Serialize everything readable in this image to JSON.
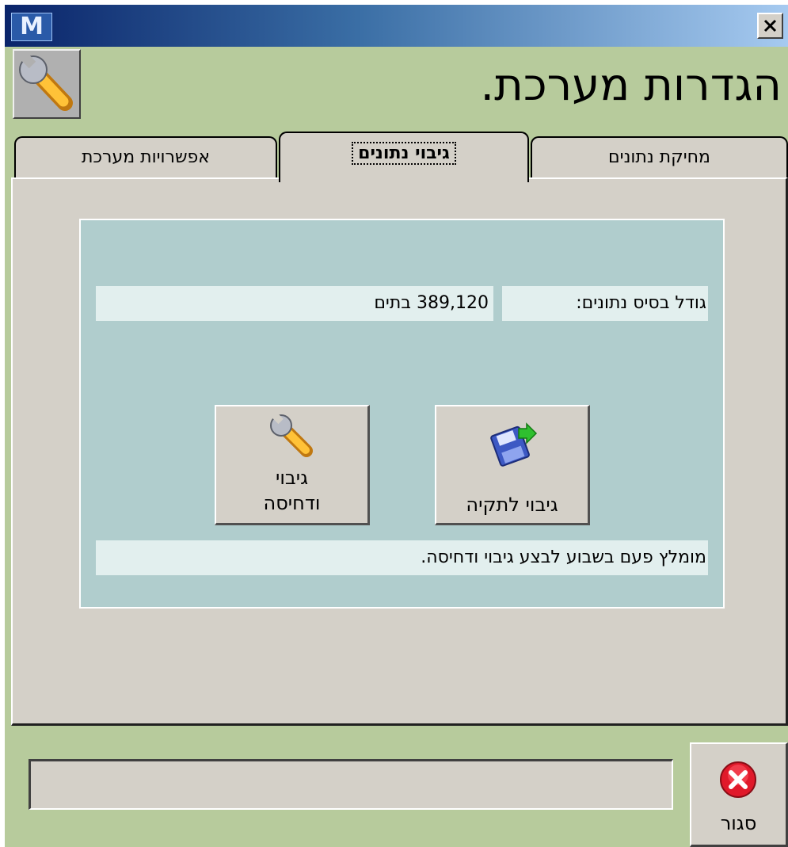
{
  "window": {
    "app_icon": "M",
    "close_glyph": "✕"
  },
  "header": {
    "title": "הגדרות מערכת."
  },
  "tabs": [
    {
      "label": "אפשרויות מערכת"
    },
    {
      "label": "גיבוי נתונים",
      "active": true
    },
    {
      "label": "מחיקת נתונים"
    }
  ],
  "backup": {
    "db_size_label": "גודל בסיס נתונים:",
    "db_size_value": "389,120 בתים",
    "backup_compress_line1": "גיבוי",
    "backup_compress_line2": "ודחיסה",
    "backup_folder_label": "גיבוי לתקיה",
    "recommendation": "מומלץ פעם בשבוע לבצע גיבוי ודחיסה."
  },
  "footer": {
    "status_text": "",
    "close_label": "סגור"
  },
  "icons": [
    "app-logo-icon",
    "close-icon",
    "wrench-icon",
    "floppy-disk-icon",
    "cancel-icon"
  ]
}
